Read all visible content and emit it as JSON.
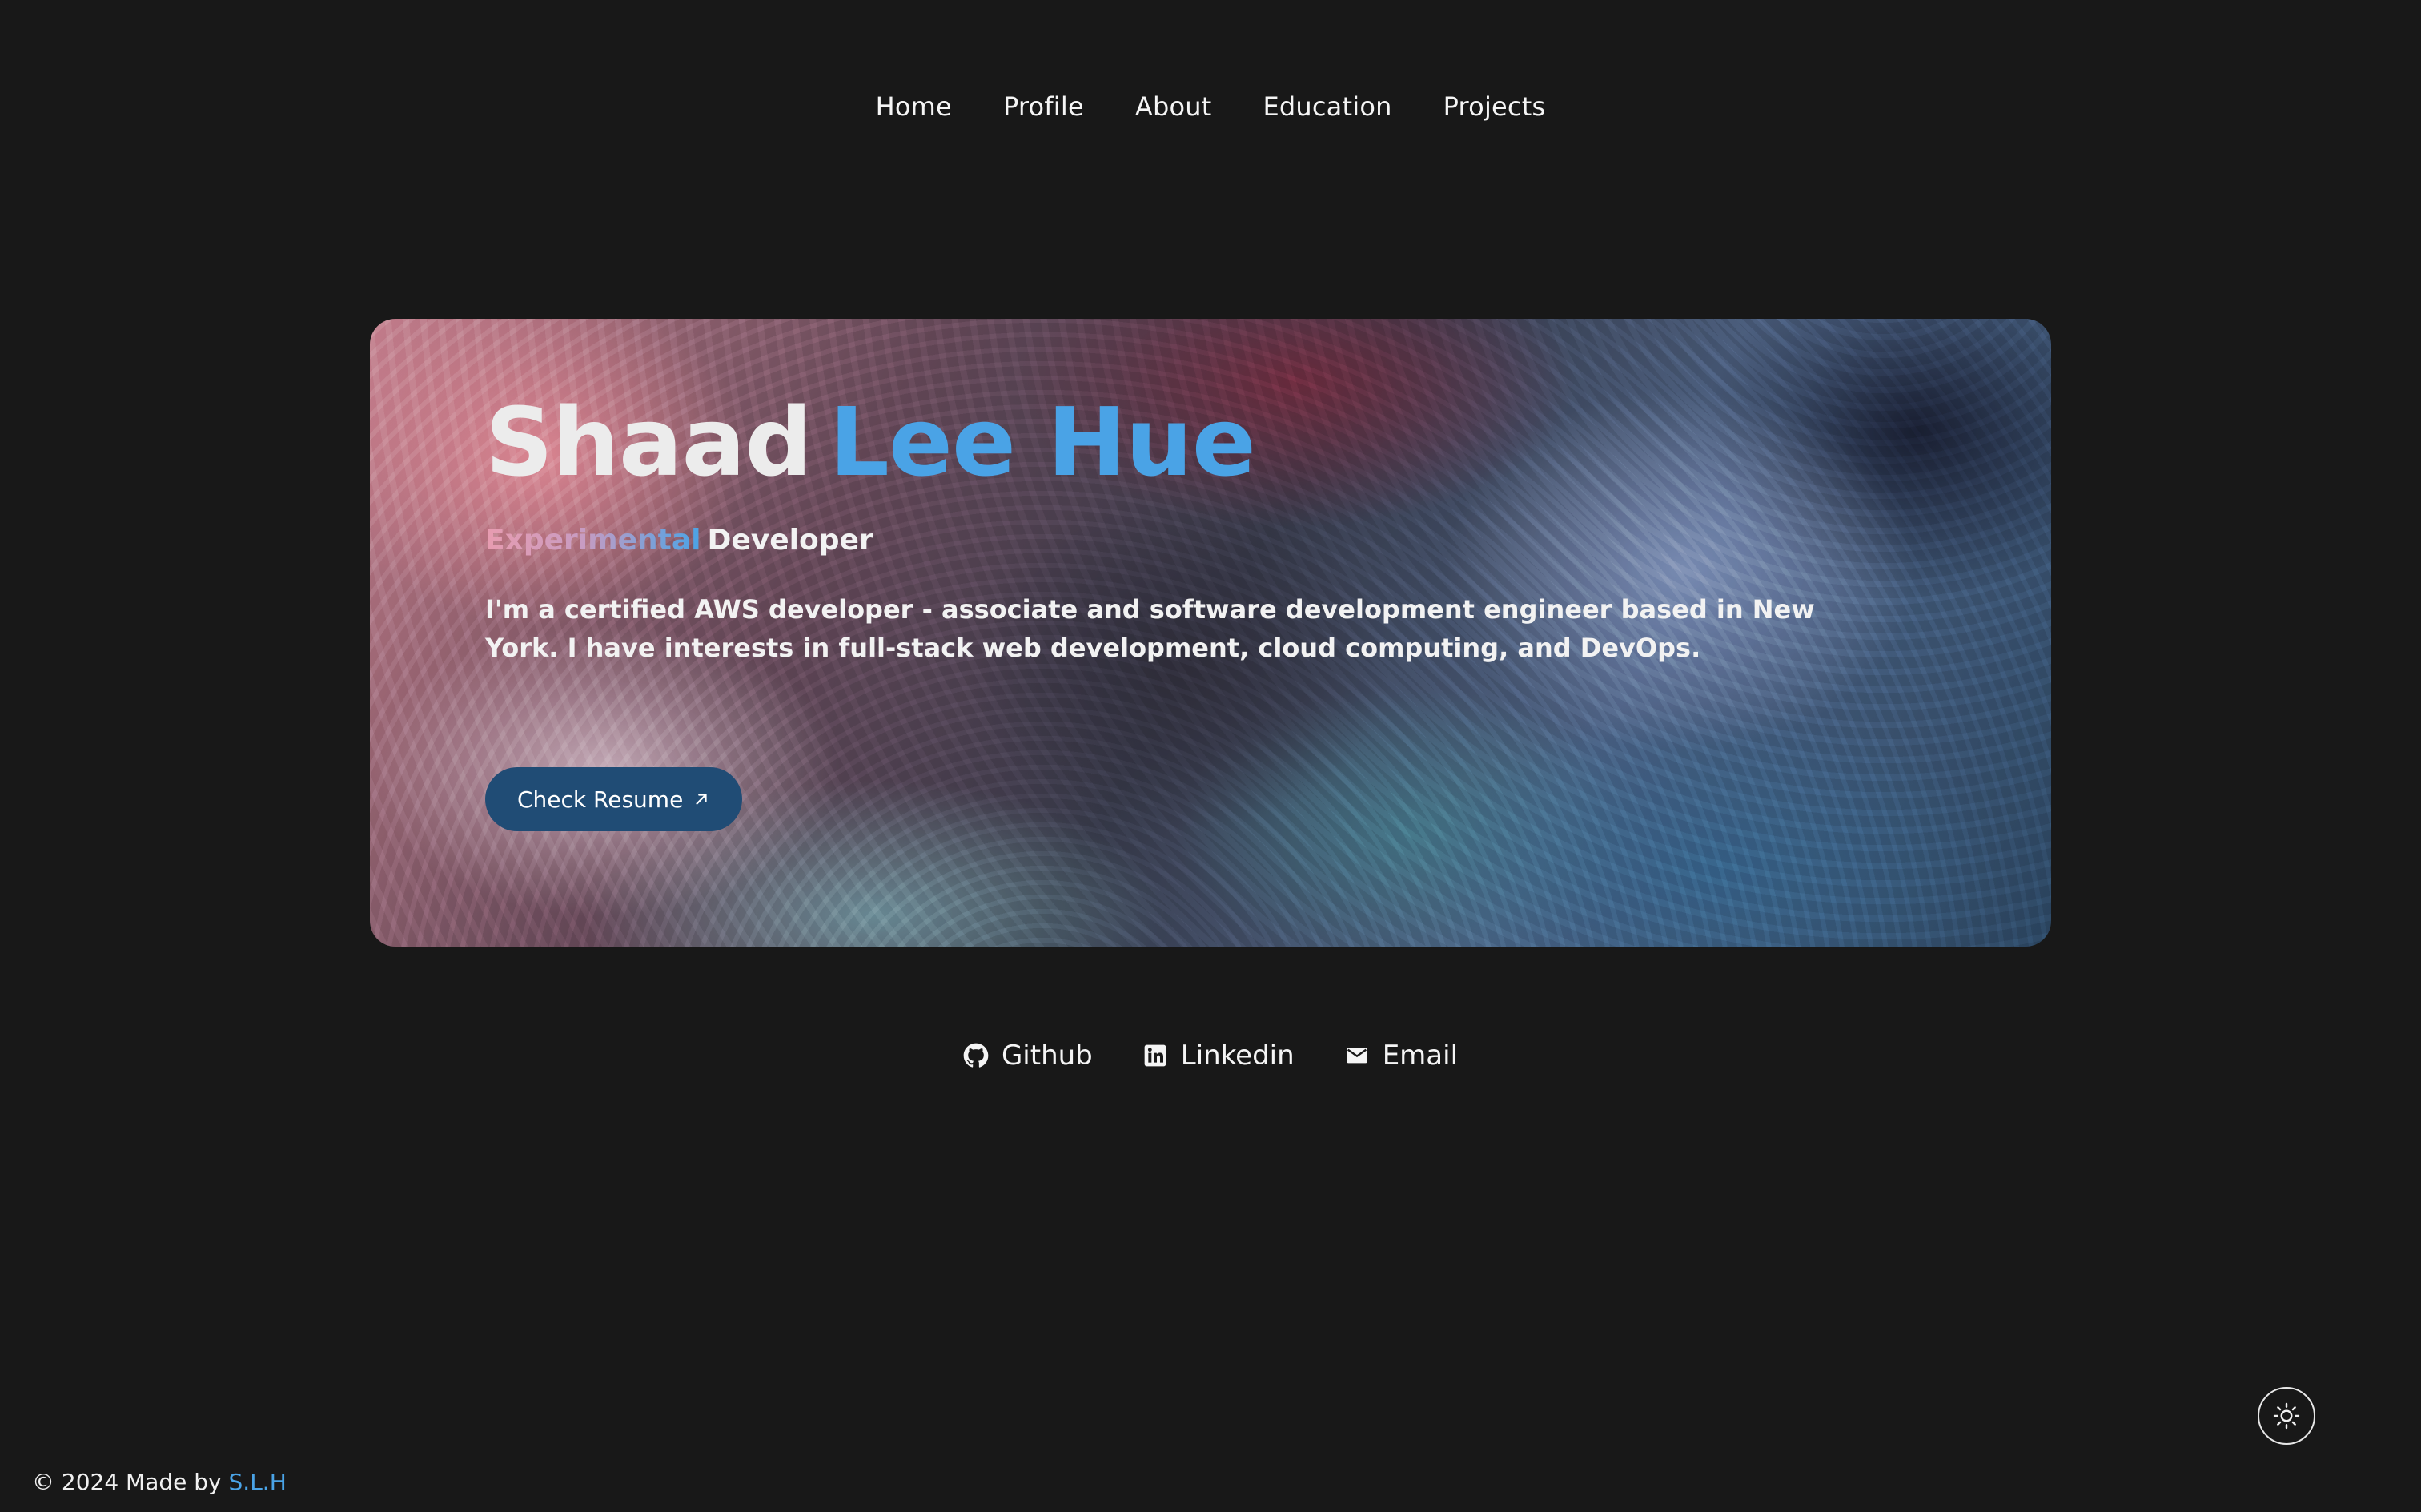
{
  "nav": {
    "items": [
      {
        "label": "Home"
      },
      {
        "label": "Profile"
      },
      {
        "label": "About"
      },
      {
        "label": "Education"
      },
      {
        "label": "Projects"
      }
    ]
  },
  "hero": {
    "first_name": "Shaad",
    "last_name": "Lee Hue",
    "subtitle_accent": "Experimental",
    "subtitle_role": "Developer",
    "description": "I'm a certified AWS developer - associate and software development engineer based in New York. I have interests in full-stack web development, cloud computing, and DevOps.",
    "resume_button": "Check Resume"
  },
  "social": {
    "items": [
      {
        "label": "Github",
        "icon": "github-icon"
      },
      {
        "label": "Linkedin",
        "icon": "linkedin-icon"
      },
      {
        "label": "Email",
        "icon": "email-icon"
      }
    ]
  },
  "theme_toggle": {
    "icon": "sun-icon"
  },
  "footer": {
    "prefix": "© 2024 Made by",
    "author": "S.L.H"
  },
  "colors": {
    "background": "#181818",
    "accent": "#4aa3e6",
    "button": "#204c75",
    "text": "#f2f2f2"
  }
}
